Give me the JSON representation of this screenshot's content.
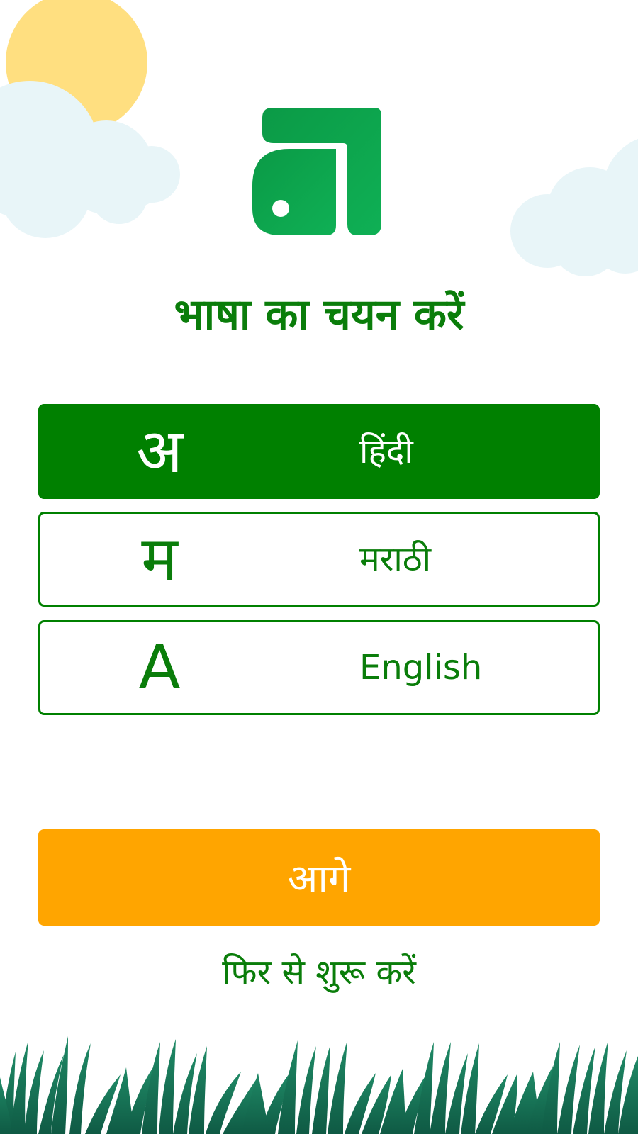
{
  "title": "भाषा का चयन करें",
  "languages": [
    {
      "glyph": "अ",
      "name": "हिंदी",
      "selected": true
    },
    {
      "glyph": "म",
      "name": "मराठी",
      "selected": false
    },
    {
      "glyph": "A",
      "name": "English",
      "selected": false
    }
  ],
  "next_label": "आगे",
  "restart_label": "फिर से शुरू करें",
  "colors": {
    "primary_green": "#008000",
    "accent_orange": "#ffa500",
    "logo_green": "#0aa24a",
    "sun": "#ffdf80",
    "cloud": "#e8f5f8",
    "grass": "#176f57"
  },
  "icons": [
    "sun-icon",
    "cloud-icon",
    "app-logo-icon",
    "grass-icon"
  ]
}
